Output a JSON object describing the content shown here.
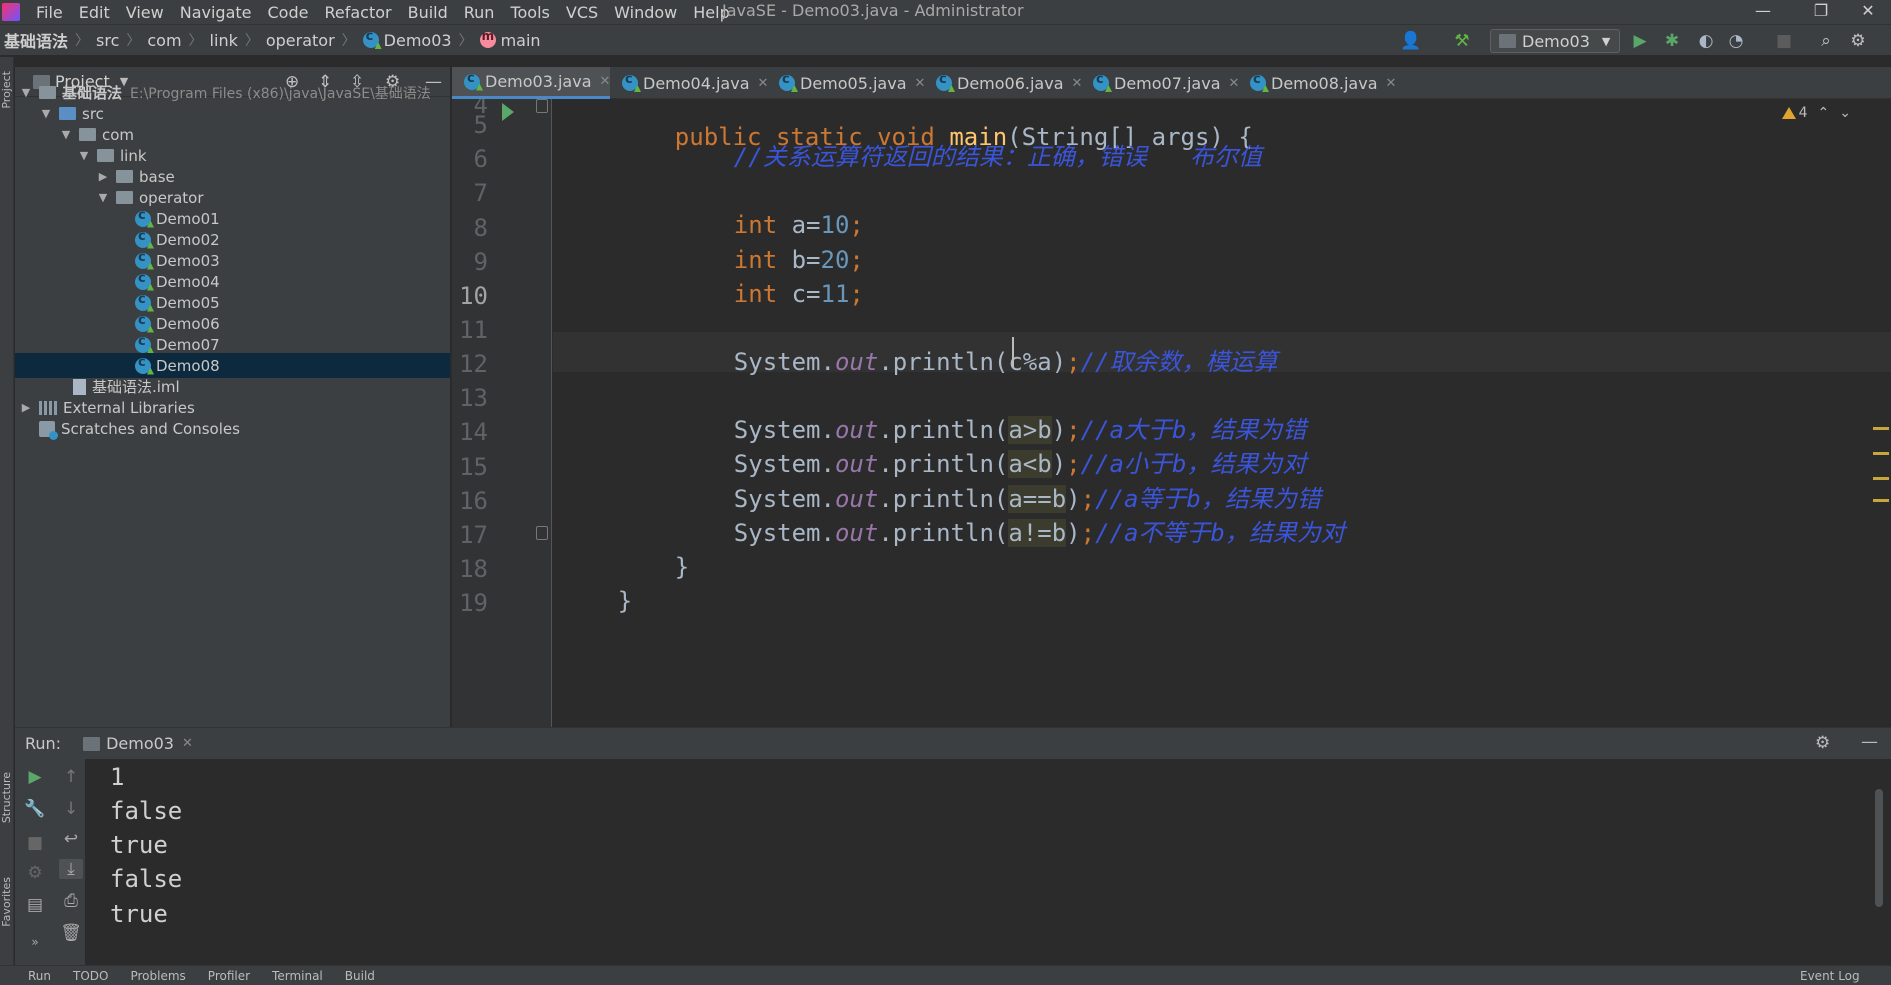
{
  "menu": [
    "File",
    "Edit",
    "View",
    "Navigate",
    "Code",
    "Refactor",
    "Build",
    "Run",
    "Tools",
    "VCS",
    "Window",
    "Help"
  ],
  "window_title": "JavaSE - Demo03.java - Administrator",
  "window_controls": {
    "minimize": "—",
    "restore": "❐",
    "close": "✕"
  },
  "breadcrumb": [
    "基础语法",
    "src",
    "com",
    "link",
    "operator",
    "Demo03",
    "main"
  ],
  "run_config": "Demo03",
  "project_panel": {
    "title": "Project",
    "root_name": "基础语法",
    "root_path": "E:\\Program Files (x86)\\java\\JavaSE\\基础语法",
    "src": "src",
    "com": "com",
    "link": "link",
    "base": "base",
    "operator": "operator",
    "classes": [
      "Demo01",
      "Demo02",
      "Demo03",
      "Demo04",
      "Demo05",
      "Demo06",
      "Demo07",
      "Demo08"
    ],
    "iml": "基础语法.iml",
    "external_libraries": "External Libraries",
    "scratches": "Scratches and Consoles"
  },
  "tabs": [
    "Demo03.java",
    "Demo04.java",
    "Demo05.java",
    "Demo06.java",
    "Demo07.java",
    "Demo08.java"
  ],
  "active_tab": "Demo03.java",
  "inspection": {
    "warnings": "4"
  },
  "line_numbers": [
    "4",
    "5",
    "6",
    "7",
    "8",
    "9",
    "10",
    "11",
    "12",
    "13",
    "14",
    "15",
    "16",
    "17",
    "18",
    "19"
  ],
  "code": {
    "l4": {
      "kw": "public static void ",
      "fn": "main",
      "rest": "(String[] args) {"
    },
    "l5": "//关系运算符返回的结果：正确，错误   布尔值",
    "l7": {
      "kw": "int ",
      "name": "a=",
      "num": "10",
      "end": ";"
    },
    "l8": {
      "kw": "int ",
      "name": "b=",
      "num": "20",
      "end": ";"
    },
    "l9": {
      "kw": "int ",
      "name": "c=",
      "num": "11",
      "end": ";"
    },
    "l11": {
      "pre": "System.",
      "field": "out",
      "mid": ".println(c%a)",
      "end": ";",
      "cmt": "//取余数，模运算"
    },
    "l13": {
      "pre": "System.",
      "field": "out",
      "mid": ".println(",
      "arg": "a>b",
      "close": ")",
      "end": ";",
      "cmt": "//a大于b，结果为错"
    },
    "l14": {
      "pre": "System.",
      "field": "out",
      "mid": ".println(",
      "arg": "a<b",
      "close": ")",
      "end": ";",
      "cmt": "//a小于b，结果为对"
    },
    "l15": {
      "pre": "System.",
      "field": "out",
      "mid": ".println(",
      "arg": "a==b",
      "close": ")",
      "end": ";",
      "cmt": "//a等于b，结果为错"
    },
    "l16": {
      "pre": "System.",
      "field": "out",
      "mid": ".println(",
      "arg": "a!=b",
      "close": ")",
      "end": ";",
      "cmt": "//a不等于b，结果为对"
    },
    "l17": "}",
    "l18": "}"
  },
  "run_panel": {
    "label": "Run:",
    "tab": "Demo03",
    "output": [
      "1",
      "false",
      "true",
      "false",
      "true"
    ]
  },
  "bottom_bar": [
    "Run",
    "TODO",
    "Problems",
    "Profiler",
    "Terminal",
    "Build",
    "Event Log"
  ],
  "stripes": {
    "project": "Project",
    "structure": "Structure",
    "favorites": "Favorites"
  },
  "colors": {
    "keyword": "#cc7832",
    "number": "#6897bb",
    "comment": "#3a55d9",
    "selection": "#0d293e"
  }
}
